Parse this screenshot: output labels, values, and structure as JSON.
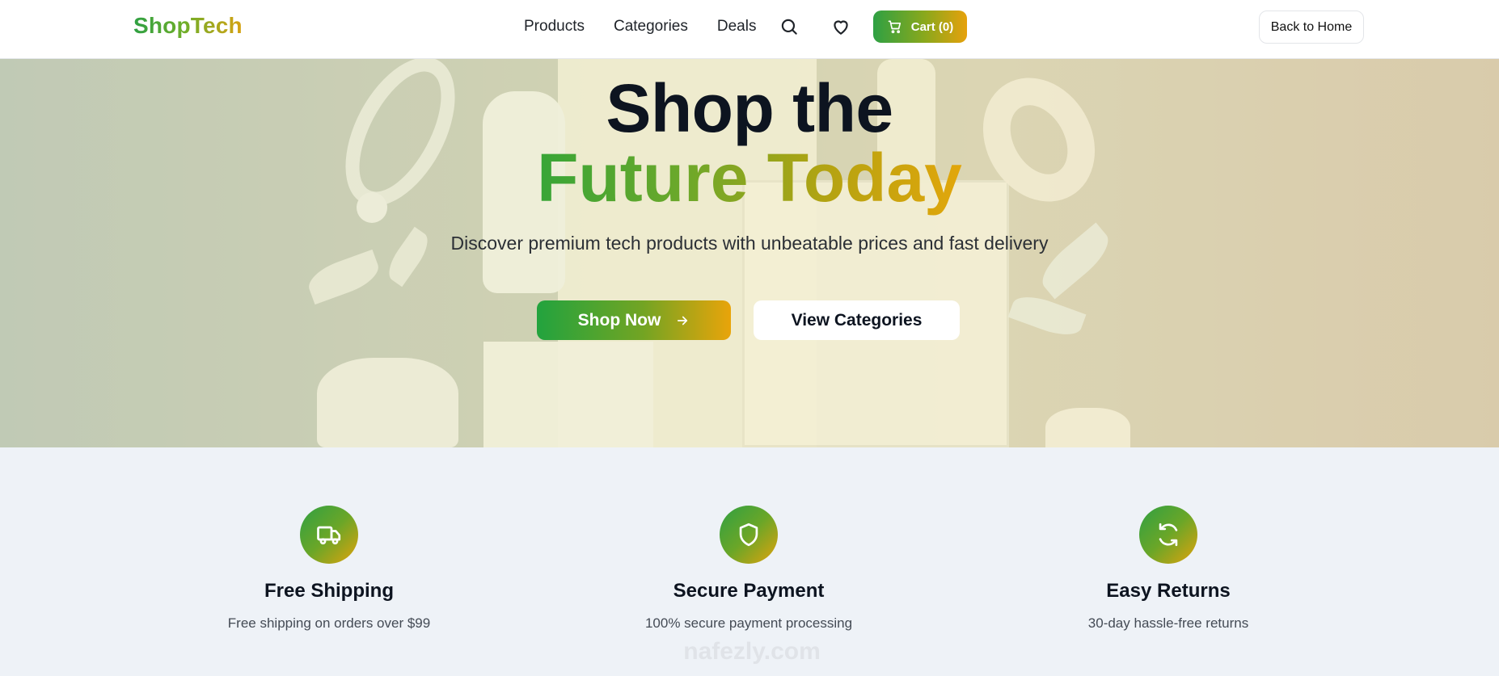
{
  "header": {
    "logo": "ShopTech",
    "nav": [
      "Products",
      "Categories",
      "Deals"
    ],
    "cart_label": "Cart (0)",
    "back_label": "Back to Home"
  },
  "hero": {
    "title_line1": "Shop the",
    "title_line2": "Future Today",
    "subtitle": "Discover premium tech products with unbeatable prices and fast delivery",
    "primary_cta": "Shop Now",
    "secondary_cta": "View Categories"
  },
  "features": [
    {
      "icon": "truck-icon",
      "title": "Free Shipping",
      "text": "Free shipping on orders over $99"
    },
    {
      "icon": "shield-icon",
      "title": "Secure Payment",
      "text": "100% secure payment processing"
    },
    {
      "icon": "refresh-icon",
      "title": "Easy Returns",
      "text": "30-day hassle-free returns"
    }
  ],
  "watermark": "nafezly.com",
  "colors": {
    "brand_green": "#2ea043",
    "brand_amber": "#e2a20c",
    "dark_text": "#0d1420",
    "features_bg": "#eef2f7"
  }
}
